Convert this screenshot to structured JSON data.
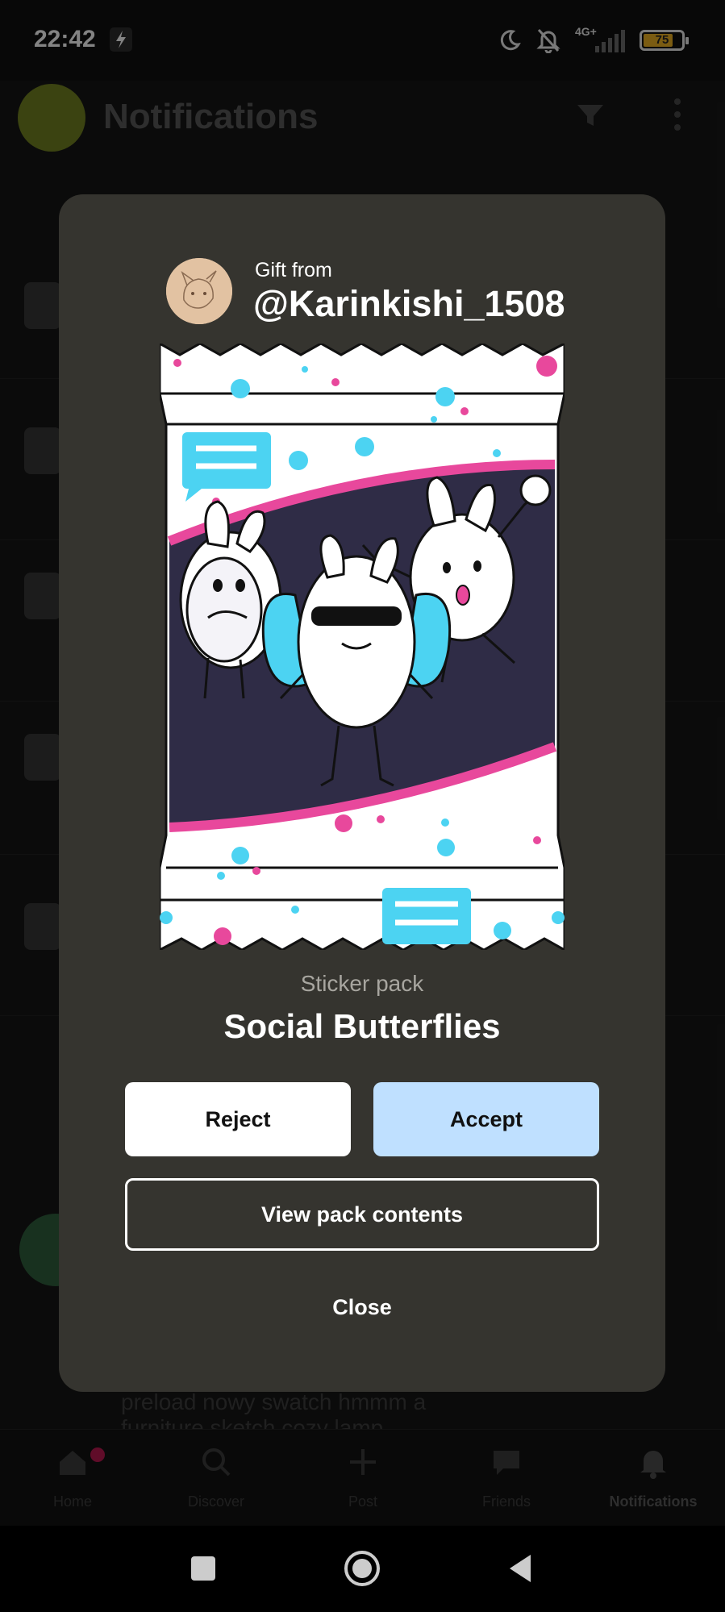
{
  "status_bar": {
    "time": "22:42",
    "network": "4G+",
    "battery": "75"
  },
  "app": {
    "title": "Notifications",
    "nav": [
      {
        "label": "Home",
        "icon": "home-icon"
      },
      {
        "label": "Discover",
        "icon": "search-icon"
      },
      {
        "label": "Post",
        "icon": "plus-icon"
      },
      {
        "label": "Friends",
        "icon": "chat-icon"
      },
      {
        "label": "Notifications",
        "icon": "bell-icon"
      }
    ],
    "background_text": [
      "preload nowy swatch hmmm a",
      "furniture sketch cozy lamp"
    ]
  },
  "gift": {
    "from_label": "Gift from",
    "username": "@Karinkishi_1508",
    "pack_kind": "Sticker pack",
    "pack_name": "Social Butterflies"
  },
  "actions": {
    "reject": "Reject",
    "accept": "Accept",
    "view": "View pack contents",
    "close": "Close"
  },
  "colors": {
    "modal_bg": "#35342f",
    "accept_bg": "#bfe0ff",
    "pack_pink": "#e8489c",
    "pack_blue": "#4cd3f2"
  }
}
